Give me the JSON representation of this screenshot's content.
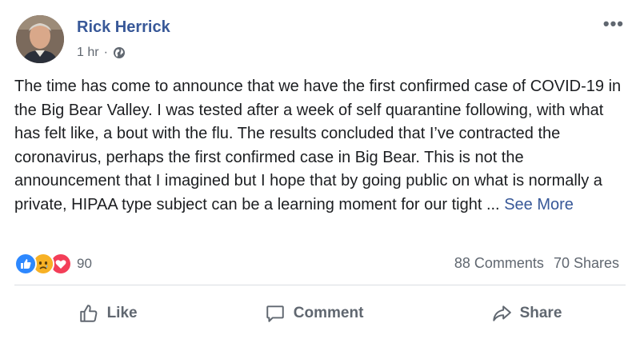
{
  "post": {
    "author": "Rick Herrick",
    "time": "1 hr",
    "separator": "·",
    "privacy_icon": "globe-icon",
    "more_icon": "more-options-icon",
    "more_label": "•••",
    "text": "The time has come to announce that we have the first confirmed case of COVID-19 in the Big Bear Valley. I was tested after a week of self quarantine following, with what has felt like, a bout with the flu. The results concluded that I’ve contracted the coronavirus, perhaps the first confirmed case in Big Bear. This is not the announcement that I imagined but I hope that by going public on what is normally a private, HIPAA type subject can be a learning moment for our tight ...",
    "see_more": "See More"
  },
  "reactions": {
    "icons": [
      "like-reaction-icon",
      "sad-reaction-icon",
      "love-reaction-icon"
    ],
    "count": "90",
    "colors": {
      "like": "#2d88ff",
      "sad": "#f7b125",
      "love": "#f33e58"
    }
  },
  "stats": {
    "comments": "88 Comments",
    "shares": "70 Shares"
  },
  "actions": {
    "like": "Like",
    "comment": "Comment",
    "share": "Share"
  },
  "colors": {
    "link": "#385898",
    "secondary": "#606770",
    "divider": "#dadde1"
  }
}
